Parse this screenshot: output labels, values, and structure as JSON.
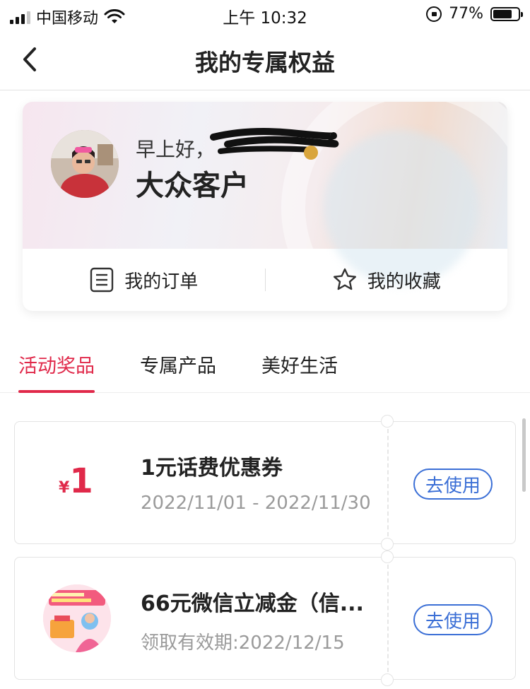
{
  "status_bar": {
    "carrier": "中国移动",
    "time": "上午 10:32",
    "battery": "77%",
    "icons": [
      "signal-icon",
      "wifi-icon",
      "rotation-lock-icon",
      "battery-icon"
    ]
  },
  "nav": {
    "title": "我的专属权益",
    "back_icon": "chevron-left-icon"
  },
  "profile": {
    "greeting": "早上好，",
    "level": "大众客户"
  },
  "actions": [
    {
      "label": "我的订单",
      "icon": "order-list-icon"
    },
    {
      "label": "我的收藏",
      "icon": "star-icon"
    }
  ],
  "tabs": [
    {
      "label": "活动奖品",
      "active": true
    },
    {
      "label": "专属产品",
      "active": false
    },
    {
      "label": "美好生活",
      "active": false
    }
  ],
  "coupons": [
    {
      "currency": "¥",
      "amount": "1",
      "title": "1元话费优惠券",
      "date": "2022/11/01 - 2022/11/30",
      "button": "去使用"
    },
    {
      "title": "66元微信立减金（信...",
      "date": "领取有效期:2022/12/15",
      "button": "去使用"
    }
  ],
  "colors": {
    "accent": "#e0294a",
    "button_blue": "#3b6fd6",
    "muted_text": "#9a9a9a"
  }
}
